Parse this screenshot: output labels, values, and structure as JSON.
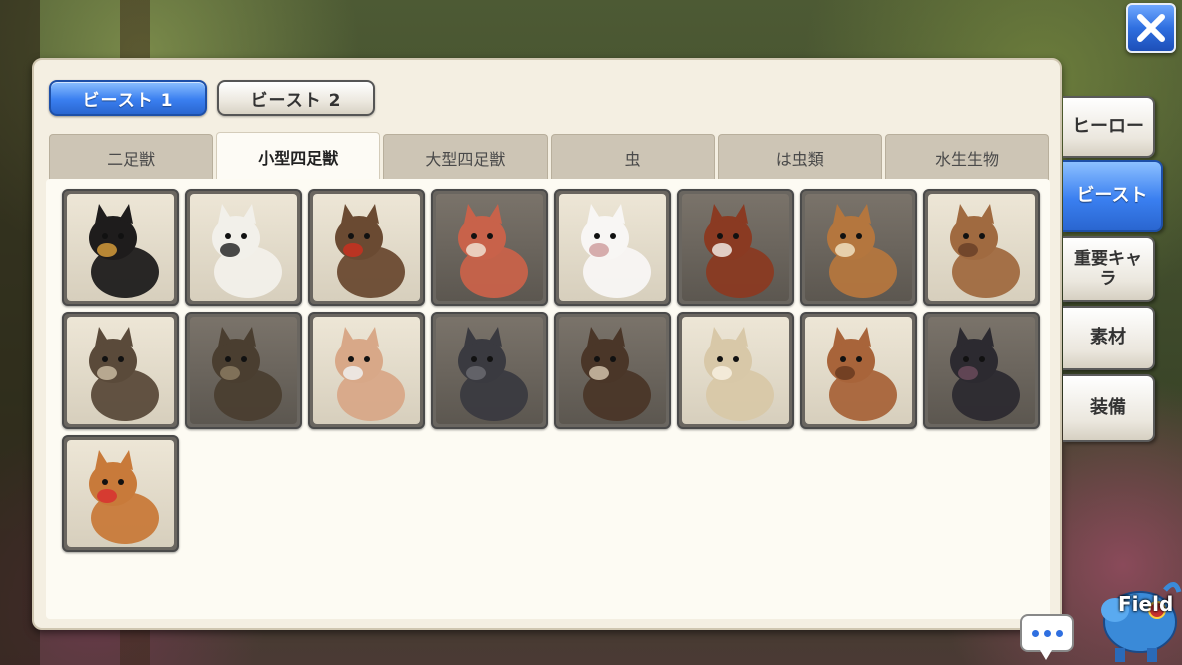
{
  "beast_tabs": [
    {
      "label": "ビースト 1",
      "active": true
    },
    {
      "label": "ビースト 2",
      "active": false
    }
  ],
  "category_tabs": [
    {
      "label": "二足獣",
      "active": false
    },
    {
      "label": "小型四足獣",
      "active": true
    },
    {
      "label": "大型四足獣",
      "active": false
    },
    {
      "label": "虫",
      "active": false
    },
    {
      "label": "は虫類",
      "active": false
    },
    {
      "label": "水生生物",
      "active": false
    }
  ],
  "side_tabs": [
    {
      "label": "ヒーロー",
      "active": false
    },
    {
      "label": "ビースト",
      "active": true
    },
    {
      "label": "重要キャラ",
      "active": false
    },
    {
      "label": "素材",
      "active": false
    },
    {
      "label": "装備",
      "active": false
    }
  ],
  "beasts": [
    {
      "name": "black-cat",
      "color": "#1e1c1c",
      "accent": "#d49a3a",
      "bg": "light"
    },
    {
      "name": "white-dog",
      "color": "#f2f0ea",
      "accent": "#2a2a2a",
      "bg": "light"
    },
    {
      "name": "hyena-beast",
      "color": "#6a4a32",
      "accent": "#c83020",
      "bg": "light"
    },
    {
      "name": "fennec-fox",
      "color": "#c8624a",
      "accent": "#f0e0d0",
      "bg": "dark"
    },
    {
      "name": "white-rabbit",
      "color": "#f8f6f4",
      "accent": "#d0a0a0",
      "bg": "light"
    },
    {
      "name": "red-panda",
      "color": "#8a3a22",
      "accent": "#f0e8e0",
      "bg": "dark"
    },
    {
      "name": "fawn",
      "color": "#b4763e",
      "accent": "#f0e0c0",
      "bg": "dark"
    },
    {
      "name": "boar-piglet",
      "color": "#a06a40",
      "accent": "#6a4028",
      "bg": "light"
    },
    {
      "name": "otter",
      "color": "#5a4a3a",
      "accent": "#c8b8a0",
      "bg": "light"
    },
    {
      "name": "pangolin",
      "color": "#4a3e30",
      "accent": "#8a7a60",
      "bg": "dark"
    },
    {
      "name": "sheep-bulb",
      "color": "#d8a888",
      "accent": "#f0f0f0",
      "bg": "light"
    },
    {
      "name": "rhino",
      "color": "#3a3a40",
      "accent": "#6a6a70",
      "bg": "dark"
    },
    {
      "name": "weasel",
      "color": "#4a3628",
      "accent": "#d0c0a8",
      "bg": "dark"
    },
    {
      "name": "hamster",
      "color": "#d8c8a8",
      "accent": "#f8f0e0",
      "bg": "light"
    },
    {
      "name": "capybara",
      "color": "#a8643a",
      "accent": "#6a3a20",
      "bg": "light"
    },
    {
      "name": "hippo",
      "color": "#2c2a30",
      "accent": "#6a4a5a",
      "bg": "dark"
    },
    {
      "name": "shiba-dog",
      "color": "#c87a3a",
      "accent": "#d83030",
      "bg": "light"
    }
  ],
  "field_label": "Field",
  "colors": {
    "accent_blue": "#3a7ff0",
    "panel_bg": "#f4efe2"
  }
}
